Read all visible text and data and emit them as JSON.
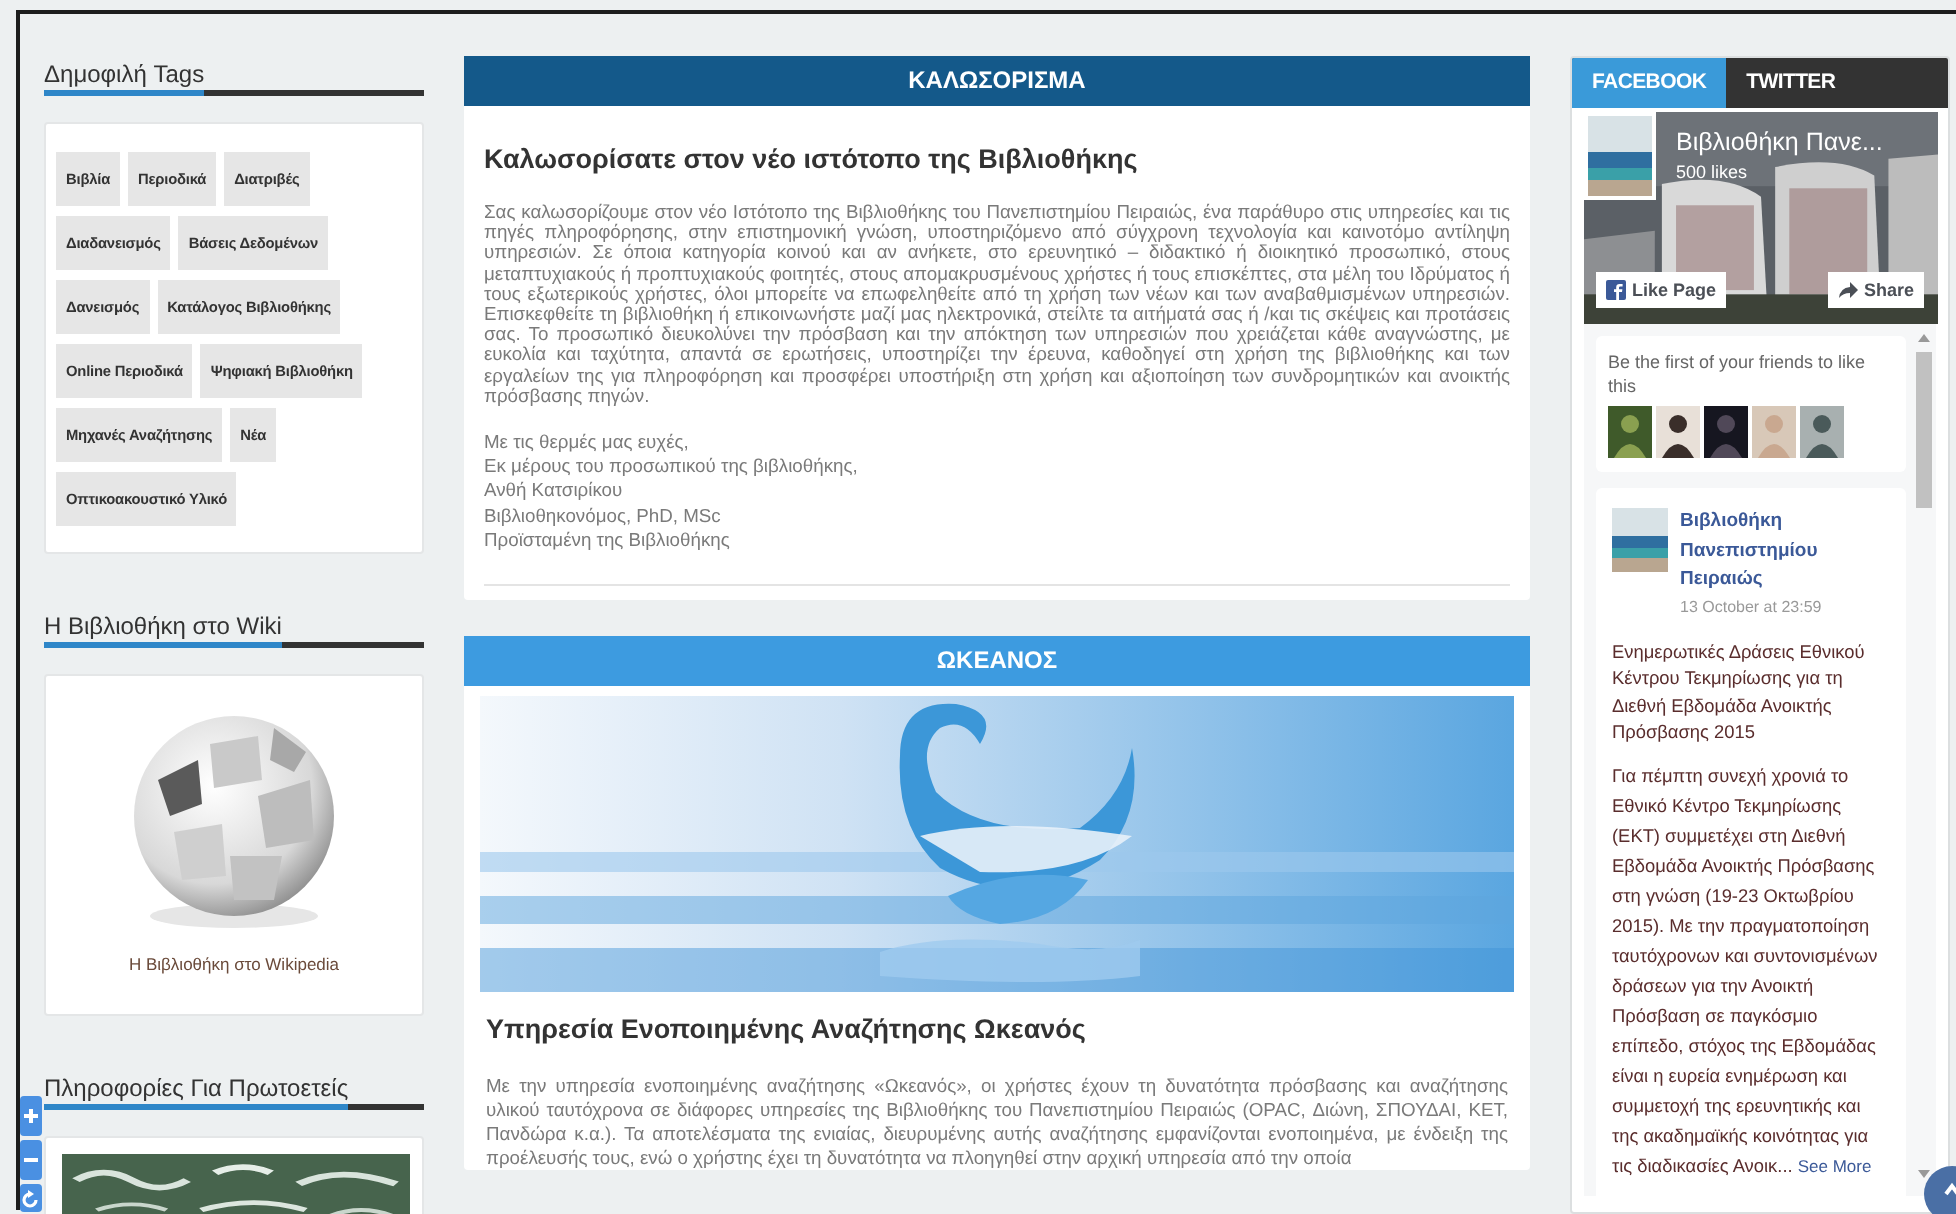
{
  "left_sidebar": {
    "widgets": [
      {
        "kind": "tags",
        "title": "Δημοφιλή Tags",
        "tags": [
          "Βιβλία",
          "Περιοδικά",
          "Διατριβές",
          "Διαδανεισμός",
          "Βάσεις Δεδομένων",
          "Δανεισμός",
          "Κατάλογος Βιβλιοθήκης",
          "Online Περιοδικά",
          "Ψηφιακή Βιβλιοθήκη",
          "Μηχανές Αναζήτησης",
          "Νέα",
          "Οπτικοακουστικό Υλικό"
        ]
      },
      {
        "kind": "wiki",
        "title": "Η Βιβλιοθήκη στο Wiki",
        "caption": "Η Βιβλιοθήκη στο Wikipedia"
      },
      {
        "title": "Πληροφορίες Για Πρωτοετείς"
      }
    ]
  },
  "main": {
    "sections": [
      {
        "kind": "text",
        "header": "ΚΑΛΩΣΟΡΙΣΜΑ",
        "color": "#14598a",
        "title": "Καλωσορίσατε στον νέο ιστότοπο της Βιβλιοθήκης",
        "paragraph": "Σας καλωσορίζουμε στον νέο Ιστότοπο της Βιβλιοθήκης του Πανεπιστημίου Πειραιώς, ένα παράθυρο στις υπηρεσίες και τις πηγές πληροφόρησης, στην επιστημονική γνώση, υποστηριζόμενο από σύγχρονη τεχνολογία και καινοτόμο αντίληψη υπηρεσιών. Σε όποια κατηγορία κοινού και αν ανήκετε, στο ερευνητικό – διδακτικό ή διοικητικό προσωπικό, στους μεταπτυχιακούς ή προπτυχιακούς φοιτητές, στους απομακρυσμένους χρήστες ή τους επισκέπτες, στα μέλη του Ιδρύματος ή τους εξωτερικούς χρήστες, όλοι μπορείτε να επωφεληθείτε από τη χρήση των νέων και των αναβαθμισμένων υπηρεσιών. Επισκεφθείτε τη βιβλιοθήκη ή επικοινωνήστε μαζί μας ηλεκτρονικά, στείλτε τα αιτήματά σας ή /και τις σκέψεις και προτάσεις σας. Το προσωπικό διευκολύνει την πρόσβαση και την απόκτηση των υπηρεσιών που χρειάζεται κάθε αναγνώστης, με ευκολία και ταχύτητα, απαντά σε ερωτήσεις, υποστηρίζει την έρευνα, καθοδηγεί στη χρήση της βιβλιοθήκης και των εργαλείων της για πληροφόρηση και προσφέρει υποστήριξη στη χρήση και αξιοποίηση των συνδρομητικών και ανοικτής πρόσβασης πηγών.",
        "signature": [
          "Με τις θερμές μας ευχές,",
          "Εκ μέρους του προσωπικού της βιβλιοθήκης,",
          "Ανθή Κατσιρίκου",
          "Βιβλιοθηκονόμος, PhD, MSc",
          "Προϊσταμένη της Βιβλιοθήκης"
        ]
      },
      {
        "kind": "banner",
        "header": "ΩΚΕΑΝΟΣ",
        "color": "#3d9be0",
        "title": "Υπηρεσία Ενοποιημένης Αναζήτησης Ωκεανός",
        "paragraph": "Με την υπηρεσία ενοποιημένης αναζήτησης «Ωκεανός», οι χρήστες έχουν τη δυνατότητα πρόσβασης και αναζήτησης υλικού ταυτόχρονα σε διάφορες υπηρεσίες της Βιβλιοθήκης του Πανεπιστημίου Πειραιώς (OPAC, Διώνη, ΣΠΟΥΔΑΙ, ΚΕΤ, Πανδώρα κ.α.). Τα αποτελέσματα της ενιαίας, διευρυμένης αυτής αναζήτησης εμφανίζονται ενοποιημένα, με ένδειξη της προέλευσής τους, ενώ ο χρήστης έχει τη δυνατότητα να πλοηγηθεί στην αρχική υπηρεσία από την οποία"
      }
    ]
  },
  "social_widget": {
    "tabs": [
      {
        "label": "FACEBOOK",
        "selected": true
      },
      {
        "label": "TWITTER",
        "selected": false
      }
    ],
    "page_name": "Βιβλιοθήκη Πανε...",
    "likes": "500 likes",
    "like_button": "Like Page",
    "share_button": "Share",
    "friends_text": "Be the first of your friends to like this",
    "post": {
      "author": "Βιβλιοθήκη Πανεπιστημίου Πειραιώς",
      "time": "13 October at 23:59",
      "title": "Ενημερωτικές Δράσεις Εθνικού Κέντρου Τεκμηρίωσης για τη Διεθνή Εβδομάδα Ανοικτής Πρόσβασης 2015",
      "body": "Για πέμπτη συνεχή χρονιά το Εθνικό Κέντρο Τεκμηρίωσης (ΕΚΤ) συμμετέχει στη Διεθνή Εβδομάδα Ανοικτής Πρόσβασης στη γνώση (19-23 Οκτωβρίου 2015). Με την πραγματοποίηση ταυτόχρονων και συντονισμένων δράσεων για την Ανοικτή Πρόσβαση σε παγκόσμιο επίπεδο, στόχος της Εβδομάδας είναι η ευρεία ενημέρωση και συμμετοχή της ερευνητικής και της ακαδημαϊκής κοινότητας για τις διαδικασίες Ανοικ...",
      "see_more": "See More"
    }
  }
}
